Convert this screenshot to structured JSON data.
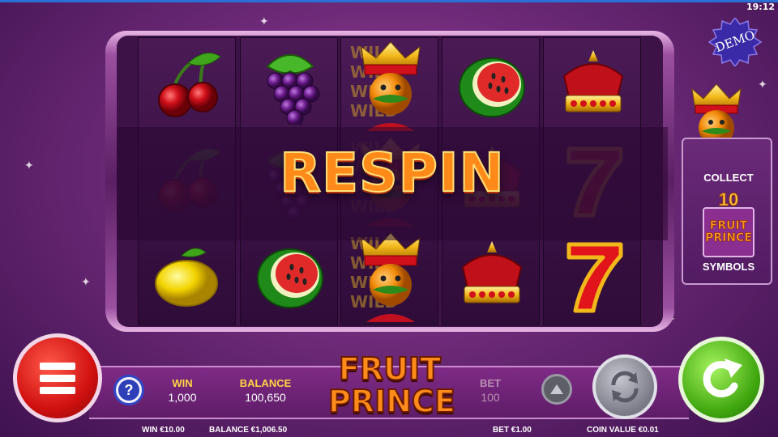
{
  "status": {
    "clock": "19:12"
  },
  "demo_badge": "DEMO",
  "reels": {
    "rows": [
      [
        "cherry",
        "grapes",
        "wild-prince",
        "watermelon",
        "crown"
      ],
      [
        "cherry",
        "grapes",
        "wild-prince",
        "crown",
        "seven"
      ],
      [
        "lemon",
        "watermelon",
        "wild-prince",
        "crown",
        "seven"
      ]
    ],
    "wild_text": "WILD"
  },
  "banner": {
    "text": "RESPIN"
  },
  "collect_panel": {
    "title": "COLLECT",
    "count": "10",
    "badge_line1": "FRUIT",
    "badge_line2": "PRINCE",
    "subtitle": "SYMBOLS"
  },
  "stats": {
    "win_label": "WIN",
    "win_value": "1,000",
    "balance_label": "BALANCE",
    "balance_value": "100,650",
    "bet_label": "BET",
    "bet_value": "100"
  },
  "logo": {
    "line1": "FRUIT",
    "line2": "PRINCE"
  },
  "footer": {
    "win": "WIN €10.00",
    "balance": "BALANCE €1,006.50",
    "bet": "BET €1.00",
    "coin_value": "COIN VALUE €0.01"
  },
  "colors": {
    "accent": "#ff8a1a",
    "spin": "#3fa60e",
    "menu": "#d01010"
  },
  "icons": {
    "menu": "hamburger-icon",
    "help": "question-icon",
    "bet_up": "arrow-up-icon",
    "autoplay": "refresh-icon",
    "spin": "spin-arrow-icon"
  }
}
